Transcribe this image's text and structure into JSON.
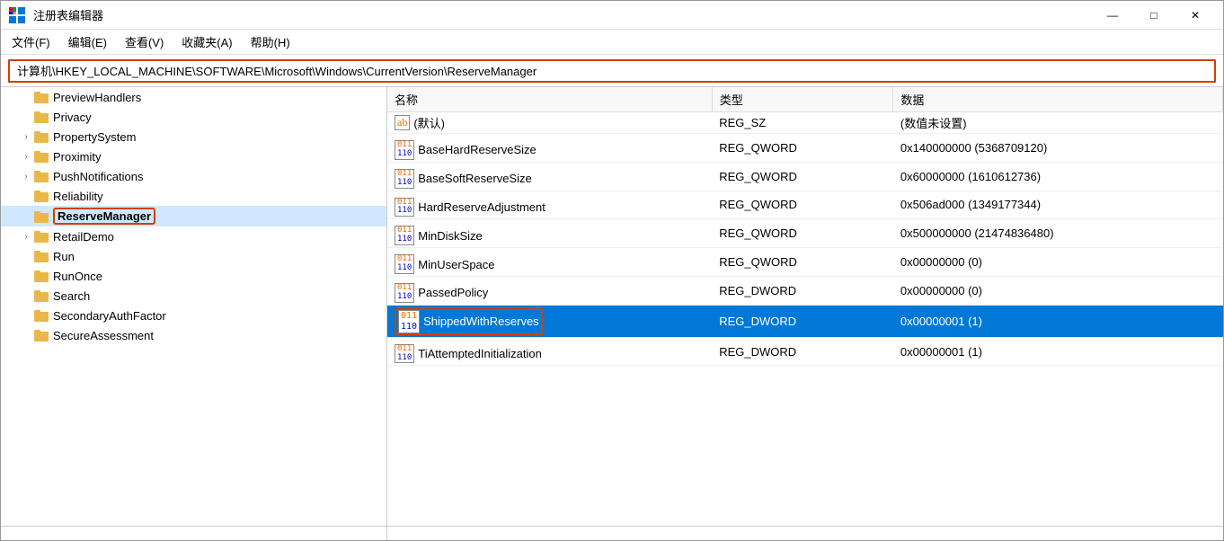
{
  "window": {
    "title": "注册表编辑器",
    "minimize_label": "—",
    "maximize_label": "□",
    "close_label": "✕"
  },
  "menu": {
    "items": [
      {
        "label": "文件(F)"
      },
      {
        "label": "编辑(E)"
      },
      {
        "label": "查看(V)"
      },
      {
        "label": "收藏夹(A)"
      },
      {
        "label": "帮助(H)"
      }
    ]
  },
  "address": {
    "value": "计算机\\HKEY_LOCAL_MACHINE\\SOFTWARE\\Microsoft\\Windows\\CurrentVersion\\ReserveManager"
  },
  "tree": {
    "items": [
      {
        "label": "PreviewHandlers",
        "indent": 1,
        "has_expand": false,
        "selected": false
      },
      {
        "label": "Privacy",
        "indent": 1,
        "has_expand": false,
        "selected": false
      },
      {
        "label": "PropertySystem",
        "indent": 1,
        "has_expand": true,
        "selected": false
      },
      {
        "label": "Proximity",
        "indent": 1,
        "has_expand": true,
        "selected": false
      },
      {
        "label": "PushNotifications",
        "indent": 1,
        "has_expand": true,
        "selected": false
      },
      {
        "label": "Reliability",
        "indent": 1,
        "has_expand": false,
        "selected": false
      },
      {
        "label": "ReserveManager",
        "indent": 1,
        "has_expand": false,
        "selected": true,
        "highlighted": true
      },
      {
        "label": "RetailDemo",
        "indent": 1,
        "has_expand": true,
        "selected": false
      },
      {
        "label": "Run",
        "indent": 1,
        "has_expand": false,
        "selected": false
      },
      {
        "label": "RunOnce",
        "indent": 1,
        "has_expand": false,
        "selected": false
      },
      {
        "label": "Search",
        "indent": 1,
        "has_expand": false,
        "selected": false
      },
      {
        "label": "SecondaryAuthFactor",
        "indent": 1,
        "has_expand": false,
        "selected": false
      },
      {
        "label": "SecureAssessment",
        "indent": 1,
        "has_expand": false,
        "selected": false
      }
    ]
  },
  "columns": {
    "name": "名称",
    "type": "类型",
    "data": "数据"
  },
  "registry_values": [
    {
      "icon": "ab",
      "name": "(默认)",
      "type": "REG_SZ",
      "data": "(数值未设置)",
      "selected": false
    },
    {
      "icon": "0110",
      "name": "BaseHardReserveSize",
      "type": "REG_QWORD",
      "data": "0x140000000 (5368709120)",
      "selected": false
    },
    {
      "icon": "0110",
      "name": "BaseSoftReserveSize",
      "type": "REG_QWORD",
      "data": "0x60000000 (1610612736)",
      "selected": false
    },
    {
      "icon": "0110",
      "name": "HardReserveAdjustment",
      "type": "REG_QWORD",
      "data": "0x506ad000 (1349177344)",
      "selected": false
    },
    {
      "icon": "0110",
      "name": "MinDiskSize",
      "type": "REG_QWORD",
      "data": "0x500000000 (21474836480)",
      "selected": false
    },
    {
      "icon": "0110",
      "name": "MinUserSpace",
      "type": "REG_QWORD",
      "data": "0x00000000 (0)",
      "selected": false
    },
    {
      "icon": "0110",
      "name": "PassedPolicy",
      "type": "REG_DWORD",
      "data": "0x00000000 (0)",
      "selected": false
    },
    {
      "icon": "0110",
      "name": "ShippedWithReserves",
      "type": "REG_DWORD",
      "data": "0x00000001 (1)",
      "selected": true
    },
    {
      "icon": "0110",
      "name": "TiAttemptedInitialization",
      "type": "REG_DWORD",
      "data": "0x00000001 (1)",
      "selected": false
    }
  ]
}
